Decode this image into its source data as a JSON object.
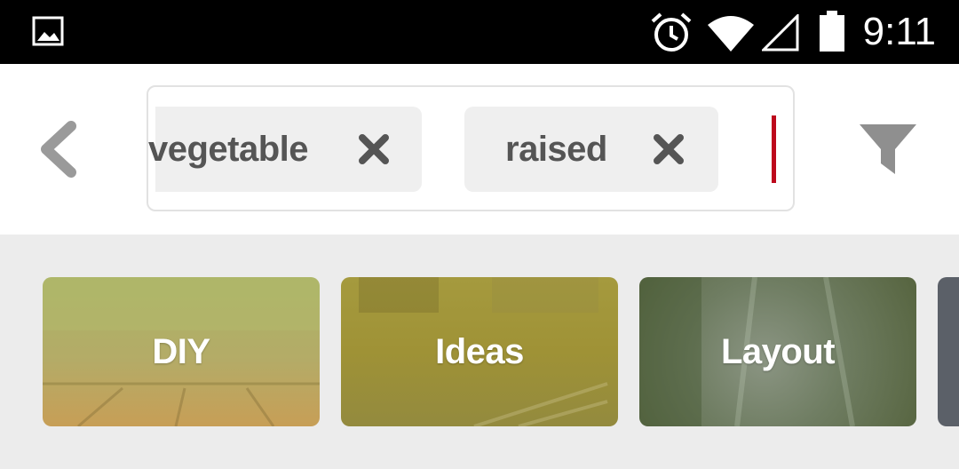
{
  "status_bar": {
    "time": "9:11",
    "icons": [
      "image-icon",
      "alarm-icon",
      "wifi-icon",
      "signal-icon",
      "battery-icon"
    ]
  },
  "search": {
    "chips": [
      {
        "label": "vegetable",
        "remove_icon": "close-icon"
      },
      {
        "label": "raised",
        "remove_icon": "close-icon"
      }
    ],
    "cursor_color": "#bd081c"
  },
  "guides": [
    {
      "label": "DIY"
    },
    {
      "label": "Ideas"
    },
    {
      "label": "Layout"
    }
  ],
  "colors": {
    "accent": "#bd081c",
    "chip_bg": "#efefef",
    "page_bg": "#ececec"
  }
}
